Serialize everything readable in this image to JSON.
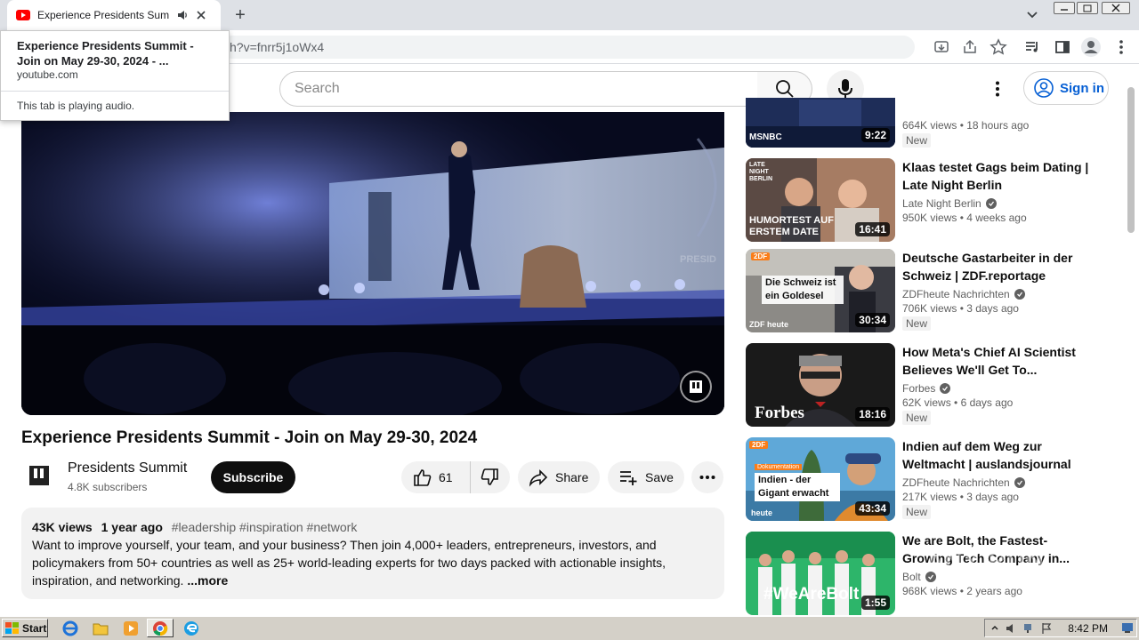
{
  "browser": {
    "tab_title": "Experience Presidents Summit -",
    "new_tab_symbol": "+",
    "url": "h?v=fnrr5j1oWx4",
    "tooltip": {
      "title": "Experience Presidents Summit - Join on May 29-30, 2024 - ...",
      "domain": "youtube.com",
      "audio_note": "This tab is playing audio."
    }
  },
  "header": {
    "search_placeholder": "Search",
    "sign_in": "Sign in"
  },
  "video": {
    "title": "Experience Presidents Summit - Join on May 29-30, 2024",
    "overlay_text": "PRESID",
    "channel": {
      "name": "Presidents Summit",
      "subscribers": "4.8K subscribers"
    },
    "subscribe_label": "Subscribe",
    "likes": "61",
    "share_label": "Share",
    "save_label": "Save",
    "description": {
      "views": "43K views",
      "age": "1 year ago",
      "tags": "#leadership #inspiration #network",
      "text": "Want to improve yourself, your team, and your business? Then join 4,000+ leaders, entrepreneurs, investors, and policymakers from 50+ countries as well as 25+ world-leading experts for two days packed with actionable insights, inspiration, and networking.",
      "more": "...more"
    }
  },
  "sidebar": {
    "items": [
      {
        "title": "",
        "channel": "MSNBC",
        "views": "664K views",
        "age": "18 hours ago",
        "duration": "9:22",
        "badge": "New",
        "thumb_text": "MSNBC"
      },
      {
        "title": "Klaas testet Gags beim Dating | Late Night Berlin",
        "channel": "Late Night Berlin",
        "views": "950K views",
        "age": "4 weeks ago",
        "duration": "16:41",
        "badge": "",
        "thumb_text": "HUMORTEST AUF ERSTEM DATE",
        "thumb_top": "LATE NIGHT BERLIN"
      },
      {
        "title": "Deutsche Gastarbeiter in der Schweiz | ZDF.reportage",
        "channel": "ZDFheute Nachrichten",
        "views": "706K views",
        "age": "3 days ago",
        "duration": "30:34",
        "badge": "New",
        "thumb_text": "Die Schweiz ist ein Goldesel",
        "thumb_logo": "ZDF heute"
      },
      {
        "title": "How Meta's Chief AI Scientist Believes We'll Get To...",
        "channel": "Forbes",
        "views": "62K views",
        "age": "6 days ago",
        "duration": "18:16",
        "badge": "New",
        "thumb_text": "Forbes"
      },
      {
        "title": "Indien auf dem Weg zur Weltmacht | auslandsjournal",
        "channel": "ZDFheute Nachrichten",
        "views": "217K views",
        "age": "3 days ago",
        "duration": "43:34",
        "badge": "New",
        "thumb_text": "Indien - der Gigant erwacht",
        "thumb_top": "Dokumentation",
        "thumb_logo": "heute"
      },
      {
        "title": "We are Bolt, the Fastest-Growing Tech Company in...",
        "channel": "Bolt",
        "views": "968K views",
        "age": "2 years ago",
        "duration": "1:55",
        "badge": "",
        "thumb_text": "#WeAreBolt"
      }
    ]
  },
  "watermark": "ANY RUN",
  "taskbar": {
    "start_label": "Start",
    "clock": "8:42 PM"
  }
}
